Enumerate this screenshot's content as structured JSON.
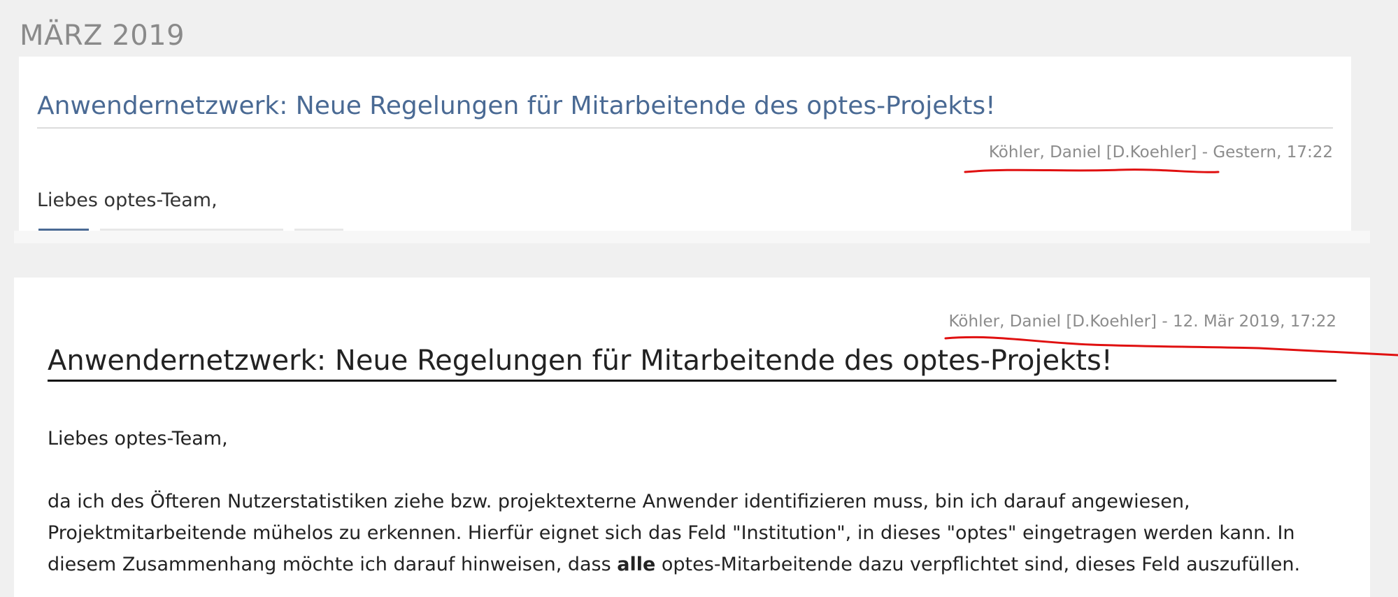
{
  "month_heading": "MÄRZ 2019",
  "list_post": {
    "title": "Anwendernetzwerk: Neue Regelungen für Mitarbeitende des optes-Projekts!",
    "author": "Köhler, Daniel [D.Koehler]",
    "separator": " - ",
    "date": "Gestern, 17:22",
    "greeting": "Liebes optes-Team,"
  },
  "detail_post": {
    "author": "Köhler, Daniel [D.Koehler]",
    "separator": " - ",
    "date": "12. Mär 2019, 17:22",
    "title": "Anwendernetzwerk: Neue Regelungen für Mitarbeitende des optes-Projekts!",
    "greeting": "Liebes optes-Team,",
    "paragraph_before_bold": "da ich des Öfteren Nutzerstatistiken ziehe bzw. projektexterne Anwender identifizieren muss, bin ich darauf angewiesen, Projektmitarbeitende mühelos zu erkennen. Hierfür eignet sich das Feld \"Institution\", in dieses \"optes\" eingetragen werden kann. In diesem Zusammenhang möchte ich darauf hinweisen, dass ",
    "paragraph_bold": "alle",
    "paragraph_after_bold": " optes-Mitarbeitende dazu verpflichtet sind, dieses Feld auszufüllen."
  },
  "colors": {
    "title_link": "#4a6a94",
    "meta_gray": "#8c8c8c",
    "annotation_red": "#e01010",
    "background": "#f0f0f0"
  }
}
